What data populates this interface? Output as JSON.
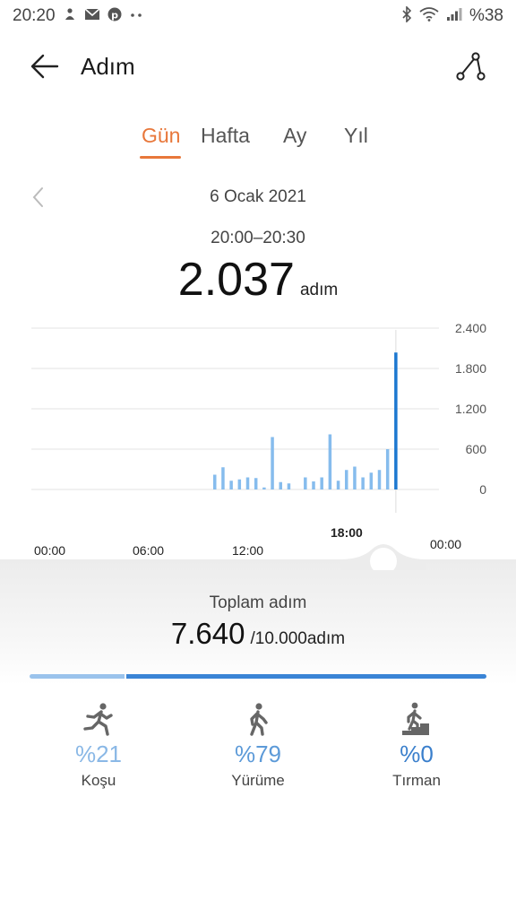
{
  "status_bar": {
    "time": "20:20",
    "battery": "%38",
    "left_icons": [
      "notification-icon",
      "mail-icon",
      "pinterest-icon",
      "more-dots-icon"
    ],
    "right_icons": [
      "bluetooth-icon",
      "wifi-icon",
      "signal-icon"
    ]
  },
  "header": {
    "title": "Adım",
    "back_icon": "back-arrow-icon",
    "share_icon": "share-icon"
  },
  "tabs": [
    {
      "label": "Gün",
      "active": true
    },
    {
      "label": "Hafta",
      "active": false
    },
    {
      "label": "Ay",
      "active": false
    },
    {
      "label": "Yıl",
      "active": false
    }
  ],
  "date": "6 Ocak 2021",
  "selected": {
    "time_range": "20:00–20:30",
    "value": "2.037",
    "unit": "adım"
  },
  "chart_data": {
    "type": "bar",
    "x_tick_labels": [
      "00:00",
      "06:00",
      "12:00",
      "18:00",
      "00:00"
    ],
    "x_range_hours": [
      0,
      24
    ],
    "y_tick_labels": [
      "2.400",
      "1.800",
      "1.200",
      "600",
      "0"
    ],
    "ylim": [
      0,
      2400
    ],
    "bars": [
      {
        "hour": 10.0,
        "value": 220
      },
      {
        "hour": 10.5,
        "value": 330
      },
      {
        "hour": 11.0,
        "value": 130
      },
      {
        "hour": 11.5,
        "value": 150
      },
      {
        "hour": 12.0,
        "value": 180
      },
      {
        "hour": 12.5,
        "value": 170
      },
      {
        "hour": 13.0,
        "value": 30
      },
      {
        "hour": 13.5,
        "value": 780
      },
      {
        "hour": 14.0,
        "value": 110
      },
      {
        "hour": 14.5,
        "value": 90
      },
      {
        "hour": 15.5,
        "value": 180
      },
      {
        "hour": 16.0,
        "value": 120
      },
      {
        "hour": 16.5,
        "value": 180
      },
      {
        "hour": 17.0,
        "value": 820
      },
      {
        "hour": 17.5,
        "value": 130
      },
      {
        "hour": 18.0,
        "value": 290
      },
      {
        "hour": 18.5,
        "value": 340
      },
      {
        "hour": 19.0,
        "value": 180
      },
      {
        "hour": 19.5,
        "value": 250
      },
      {
        "hour": 20.0,
        "value": 290
      },
      {
        "hour": 20.5,
        "value": 600
      },
      {
        "hour": 21.0,
        "value": 2037,
        "selected": true
      }
    ],
    "colors": {
      "bar": "#86bced",
      "selected_bar": "#1c78d0",
      "grid": "#e3e3e3"
    }
  },
  "summary": {
    "title": "Toplam adım",
    "value": "7.640",
    "goal": "/10.000adım",
    "progress": {
      "running_fraction": 0.21,
      "walking_fraction": 0.79
    }
  },
  "activities": [
    {
      "icon": "running-icon",
      "percent": "%21",
      "label": "Koşu",
      "color": "#8ab8e6"
    },
    {
      "icon": "walking-icon",
      "percent": "%79",
      "label": "Yürüme",
      "color": "#5c9ad8"
    },
    {
      "icon": "climbing-icon",
      "percent": "%0",
      "label": "Tırman",
      "color": "#3a7fcc"
    }
  ]
}
